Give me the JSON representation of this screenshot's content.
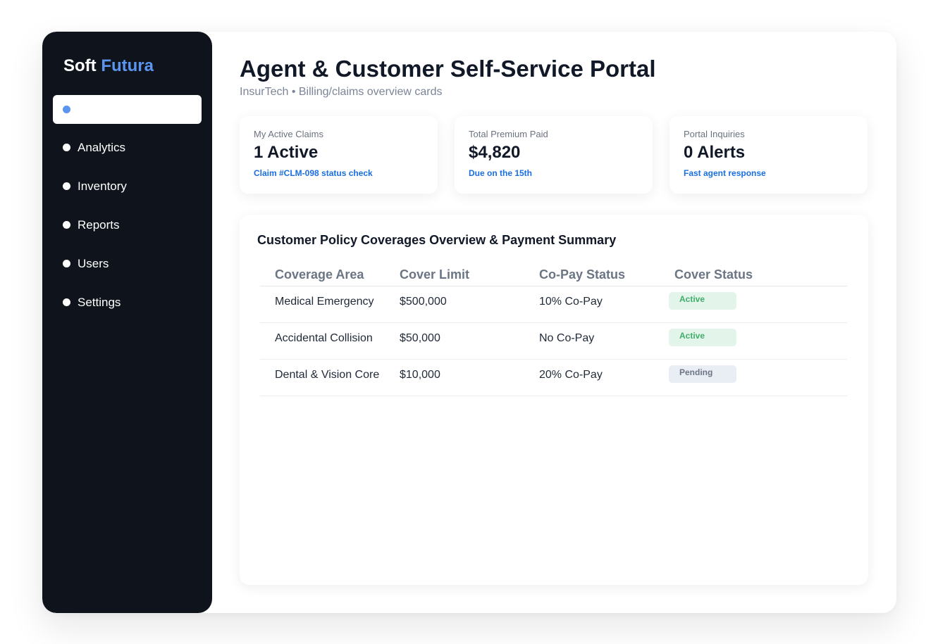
{
  "brand": {
    "first": "Soft",
    "second": "Futura"
  },
  "sidebar": {
    "items": [
      {
        "label": ""
      },
      {
        "label": "Analytics"
      },
      {
        "label": "Inventory"
      },
      {
        "label": "Reports"
      },
      {
        "label": "Users"
      },
      {
        "label": "Settings"
      }
    ]
  },
  "header": {
    "title": "Agent & Customer Self-Service Portal",
    "subtitle": "InsurTech • Billing/claims overview cards"
  },
  "cards": [
    {
      "label": "My Active Claims",
      "value": "1 Active",
      "note": "Claim #CLM-098 status check"
    },
    {
      "label": "Total Premium Paid",
      "value": "$4,820",
      "note": "Due on the 15th"
    },
    {
      "label": "Portal Inquiries",
      "value": "0 Alerts",
      "note": "Fast agent response"
    }
  ],
  "panel": {
    "title": "Customer Policy Coverages Overview & Payment Summary",
    "columns": [
      "Coverage Area",
      "Cover Limit",
      "Co-Pay Status",
      "Cover Status"
    ],
    "rows": [
      {
        "area": "Medical Emergency",
        "limit": "$500,000",
        "copay": "10% Co-Pay",
        "status": "Active"
      },
      {
        "area": "Accidental Collision",
        "limit": "$50,000",
        "copay": "No Co-Pay",
        "status": "Active"
      },
      {
        "area": "Dental & Vision Core",
        "limit": "$10,000",
        "copay": "20% Co-Pay",
        "status": "Pending"
      }
    ]
  },
  "colors": {
    "sidebar_bg": "#0e131c",
    "accent": "#5b95f0",
    "link": "#1a6ee0",
    "status_active": "#3fae6a",
    "status_pending": "#6b7584"
  }
}
